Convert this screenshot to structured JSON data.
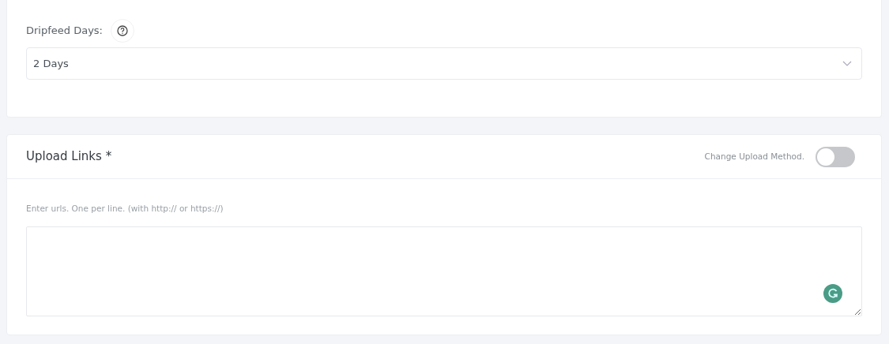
{
  "dripfeed": {
    "label": "Dripfeed Days:",
    "value": "2 Days"
  },
  "upload": {
    "title": "Upload Links *",
    "toggle_label": "Change Upload Method.",
    "toggle_on": false,
    "hint": "Enter urls. One per line. (with http:// or https://)"
  }
}
